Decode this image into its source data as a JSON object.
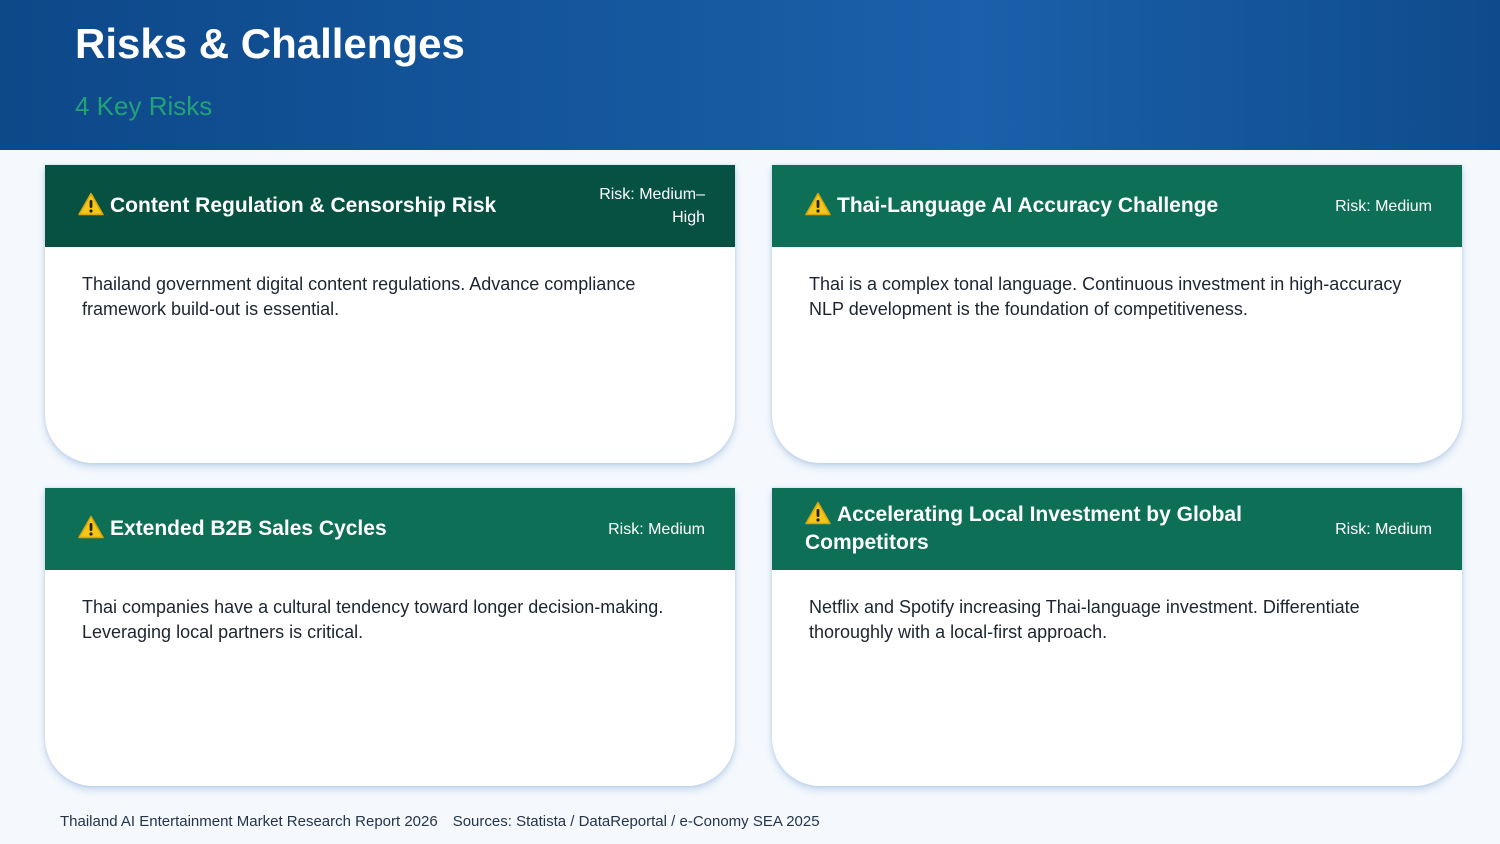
{
  "header": {
    "title": "Risks & Challenges",
    "subtitle": "4 Key Risks"
  },
  "colors": {
    "header_blue": "#1a60aa",
    "accent_green": "#23a276",
    "card_head_green": "#0e6f57",
    "card_head_dark_green": "#075142",
    "warning_yellow": "#f5c518"
  },
  "cards": [
    {
      "icon": "warning-icon",
      "title": "Content Regulation & Censorship Risk",
      "risk_line1": "Risk: Medium–",
      "risk_line2": "High",
      "body": "Thailand government digital content regulations. Advance compliance framework build-out is essential."
    },
    {
      "icon": "warning-icon",
      "title": "Thai-Language AI Accuracy Challenge",
      "risk_line1": "Risk: Medium",
      "body": "Thai is a complex tonal language. Continuous investment in high-accuracy NLP development is the foundation of competitiveness."
    },
    {
      "icon": "warning-icon",
      "title": "Extended B2B Sales Cycles",
      "risk_line1": "Risk: Medium",
      "body": "Thai companies have a cultural tendency toward longer decision-making. Leveraging local partners is critical."
    },
    {
      "icon": "warning-icon",
      "title": "Accelerating Local Investment by Global Competitors",
      "risk_line1": "Risk: Medium",
      "body": "Netflix and Spotify increasing Thai-language investment. Differentiate thoroughly with a local-first approach."
    }
  ],
  "footer": {
    "report": "Thailand AI Entertainment Market Research Report 2026",
    "sources": "Sources: Statista / DataReportal / e-Conomy SEA 2025"
  }
}
